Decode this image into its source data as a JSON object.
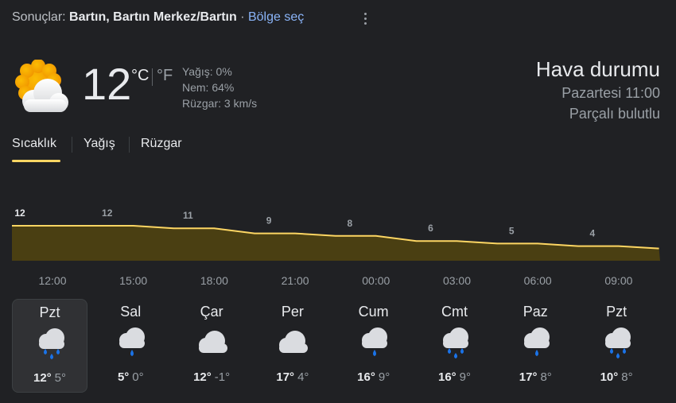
{
  "header": {
    "results_label": "Sonuçlar:",
    "location": "Bartın, Bartın Merkez/Bartın",
    "separator": " · ",
    "region_link": "Bölge seç"
  },
  "current": {
    "icon": "partly-cloudy-icon",
    "temp": "12",
    "unit_c": "°C",
    "unit_f": "°F",
    "precip": "Yağış: 0%",
    "humidity": "Nem: 64%",
    "wind": "Rüzgar: 3 km/s",
    "title": "Hava durumu",
    "datetime": "Pazartesi 11:00",
    "condition": "Parçalı bulutlu"
  },
  "tabs": [
    "Sıcaklık",
    "Yağış",
    "Rüzgar"
  ],
  "hourly": {
    "hours": [
      "12:00",
      "15:00",
      "18:00",
      "21:00",
      "00:00",
      "03:00",
      "06:00",
      "09:00"
    ],
    "temps": [
      12,
      12,
      11,
      9,
      8,
      6,
      5,
      4
    ]
  },
  "colors": {
    "accent": "#fdd663",
    "area_fill": "#4a3f12",
    "link": "#8ab4f8"
  },
  "days": [
    {
      "name": "Pzt",
      "icon": "rain-icon",
      "hi": "12°",
      "lo": "5°"
    },
    {
      "name": "Sal",
      "icon": "showers-icon",
      "hi": "5°",
      "lo": "0°"
    },
    {
      "name": "Çar",
      "icon": "cloudy-icon",
      "hi": "12°",
      "lo": "-1°"
    },
    {
      "name": "Per",
      "icon": "cloudy-icon",
      "hi": "17°",
      "lo": "4°"
    },
    {
      "name": "Cum",
      "icon": "showers-icon",
      "hi": "16°",
      "lo": "9°"
    },
    {
      "name": "Cmt",
      "icon": "rain-icon",
      "hi": "16°",
      "lo": "9°"
    },
    {
      "name": "Paz",
      "icon": "showers-icon",
      "hi": "17°",
      "lo": "8°"
    },
    {
      "name": "Pzt",
      "icon": "rain-icon",
      "hi": "10°",
      "lo": "8°"
    }
  ]
}
